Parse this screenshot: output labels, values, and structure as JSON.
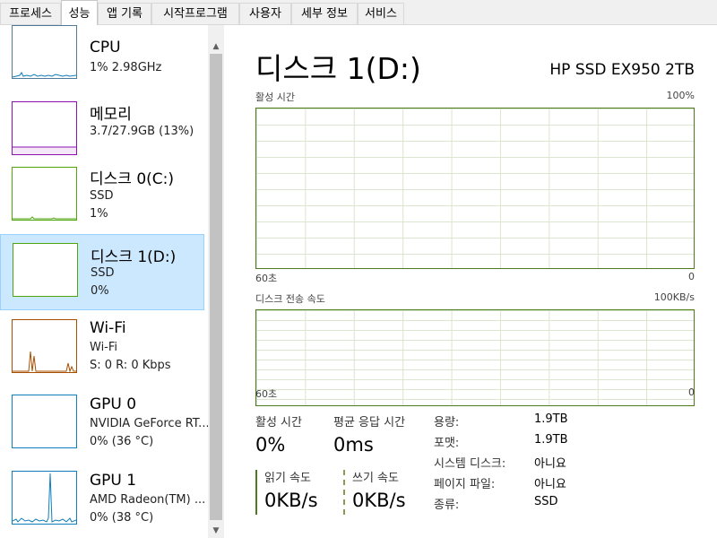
{
  "tabs": [
    {
      "label": "프로세스",
      "active": false
    },
    {
      "label": "성능",
      "active": true
    },
    {
      "label": "앱 기록",
      "active": false
    },
    {
      "label": "시작프로그램",
      "active": false
    },
    {
      "label": "사용자",
      "active": false
    },
    {
      "label": "세부 정보",
      "active": false
    },
    {
      "label": "서비스",
      "active": false
    }
  ],
  "sidebar": {
    "items": [
      {
        "name": "CPU",
        "line1": "1% 2.98GHz",
        "line2": "",
        "selected": false
      },
      {
        "name": "메모리",
        "line1": "3.7/27.9GB (13%)",
        "line2": "",
        "selected": false
      },
      {
        "name": "디스크 0(C:)",
        "line1": "SSD",
        "line2": "1%",
        "selected": false
      },
      {
        "name": "디스크 1(D:)",
        "line1": "SSD",
        "line2": "0%",
        "selected": true
      },
      {
        "name": "Wi-Fi",
        "line1": "Wi-Fi",
        "line2": "S: 0 R: 0 Kbps",
        "selected": false
      },
      {
        "name": "GPU 0",
        "line1": "NVIDIA GeForce RT...",
        "line2": "0% (36 °C)",
        "selected": false
      },
      {
        "name": "GPU 1",
        "line1": "AMD Radeon(TM) ...",
        "line2": "0% (38 °C)",
        "selected": false
      }
    ]
  },
  "main": {
    "title": "디스크 1(D:)",
    "model": "HP SSD EX950 2TB",
    "graph1": {
      "label": "활성 시간",
      "max": "100%",
      "time": "60초",
      "min": "0"
    },
    "graph2": {
      "label": "디스크 전송 속도",
      "max": "100KB/s",
      "time": "60초",
      "min": "0"
    },
    "stats": {
      "active_time_label": "활성 시간",
      "active_time_value": "0%",
      "response_label": "평균 응답 시간",
      "response_value": "0ms",
      "read_label": "읽기 속도",
      "read_value": "0KB/s",
      "write_label": "쓰기 속도",
      "write_value": "0KB/s"
    },
    "props": [
      {
        "label": "용량:",
        "value": "1.9TB"
      },
      {
        "label": "포맷:",
        "value": "1.9TB"
      },
      {
        "label": "시스템 디스크:",
        "value": "아니요"
      },
      {
        "label": "페이지 파일:",
        "value": "아니요"
      },
      {
        "label": "종류:",
        "value": "SSD"
      }
    ]
  },
  "colors": {
    "selected_bg": "#cce8ff",
    "disk_graph_border": "#4e7a1e",
    "cpu_line": "#117dbb",
    "memory_line": "#8b12ae",
    "disk_line": "#4da60c",
    "wifi_line": "#a74f01"
  },
  "icons": {
    "scroll_up": "chevron-up-icon",
    "scroll_down": "chevron-down-icon"
  }
}
